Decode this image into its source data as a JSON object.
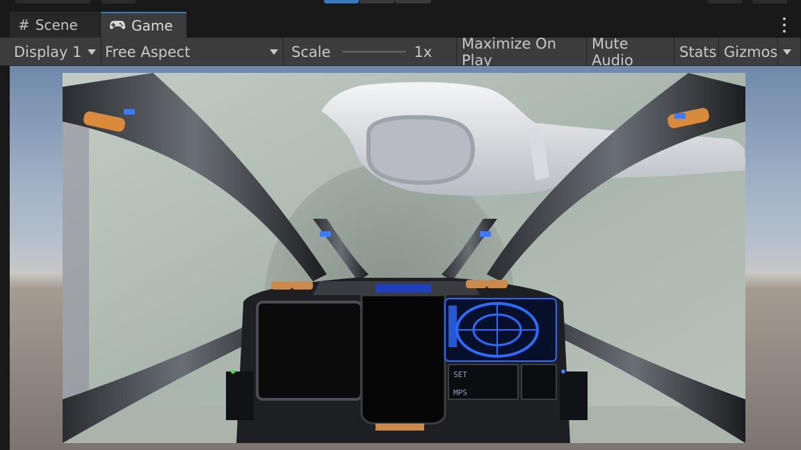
{
  "tabs": {
    "scene": {
      "label": "Scene",
      "icon": "hash-icon"
    },
    "game": {
      "label": "Game",
      "icon": "gamepad-icon"
    }
  },
  "game_toolbar": {
    "display": "Display 1",
    "aspect": "Free Aspect",
    "scale_label": "Scale",
    "scale_value": "1x",
    "maximize_on_play": "Maximize On Play",
    "mute_audio": "Mute Audio",
    "stats": "Stats",
    "gizmos": "Gizmos"
  },
  "hud": {
    "set_label": "SET",
    "mps_label": "MPS"
  },
  "colors": {
    "accent": "#3a79bb",
    "hud_blue": "#2b6cff",
    "panel_bg": "#3c3c3c",
    "editor_bg": "#191919"
  }
}
